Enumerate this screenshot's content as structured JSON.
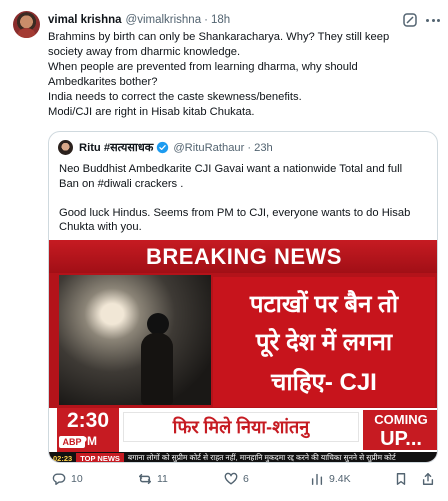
{
  "author": {
    "name": "vimal krishna",
    "handle": "@vimalkrishna",
    "separator": "·",
    "time": "18h"
  },
  "tweet_lines": [
    "Brahmins by birth can only be Shankaracharya. Why? They still keep",
    "society away from dharmic knowledge.",
    "When people are prevented from learning dharma, why should",
    "Ambedkarites bother?",
    "India needs to correct the caste skewness/benefits.",
    "Modi/CJI are right in Hisab kitab Chukata."
  ],
  "quote": {
    "name": "Ritu #सत्यसाधक",
    "handle": "@RituRathaur",
    "separator": "·",
    "time": "23h",
    "verified_color": "#1d9bf0",
    "lines": [
      "Neo Buddhist Ambedkarite CJI Gavai want a nationwide Total and full",
      "Ban on #diwali crackers .",
      "",
      "Good luck Hindus. Seems from PM to CJI, everyone wants to do Hisab",
      "Chukta with you."
    ],
    "media": {
      "banner": "BREAKING NEWS",
      "hindi_lines": [
        "पटाखों पर बैन तो",
        "पूरे देश में लगना",
        "चाहिए- CJI"
      ],
      "clock": "2:30",
      "ampm": "PM",
      "headline": "फिर मिले निया-शांतनु",
      "coming_1": "COMING",
      "coming_2": "UP...",
      "logo": "ABP",
      "strip_time": "02:23",
      "top_news": "TOP NEWS",
      "scroll_text": "बगाना लोगों को सुप्रीम कोर्ट से राहत नहीं, मानहानि मुकदमा रद्द करने की याचिका सुनने से सुप्रीम कोर्ट"
    }
  },
  "actions": {
    "replies": "10",
    "reposts": "11",
    "likes": "6",
    "views": "9.4K"
  },
  "colors": {
    "text": "#0f1419",
    "secondary": "#536471",
    "border": "#cfd9de",
    "news_red": "#c61b22"
  },
  "icons": [
    "grok-icon",
    "more-icon",
    "verified-icon",
    "reply-icon",
    "repost-icon",
    "like-icon",
    "views-icon",
    "bookmark-icon",
    "share-icon"
  ]
}
